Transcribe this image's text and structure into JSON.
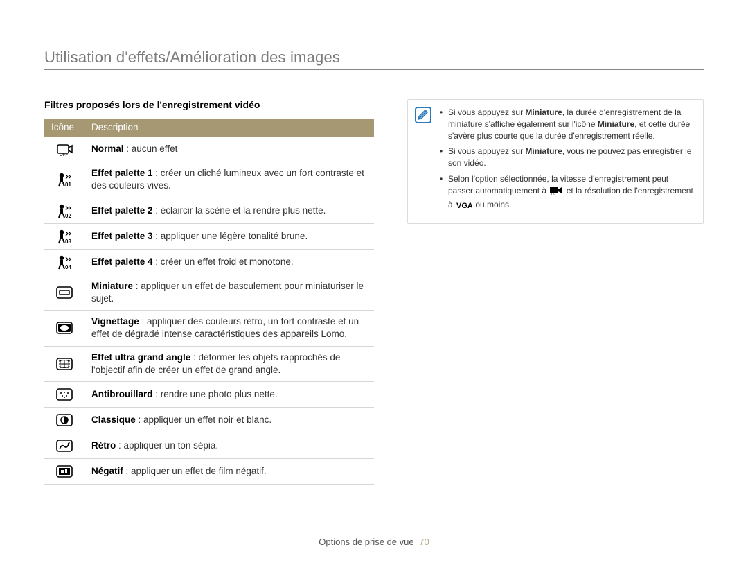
{
  "header": {
    "title": "Utilisation d'effets/Amélioration des images"
  },
  "section": {
    "heading": "Filtres proposés lors de l'enregistrement vidéo"
  },
  "table": {
    "col_icon": "Icône",
    "col_desc": "Description",
    "rows": [
      {
        "icon": "normal",
        "strong": "Normal",
        "body": " : aucun effet"
      },
      {
        "icon": "pal1",
        "strong": "Effet palette 1",
        "body": " : créer un cliché lumineux avec un fort contraste et des couleurs vives."
      },
      {
        "icon": "pal2",
        "strong": "Effet palette 2",
        "body": " : éclaircir la scène et la rendre plus nette."
      },
      {
        "icon": "pal3",
        "strong": "Effet palette 3",
        "body": " : appliquer une légère tonalité brune."
      },
      {
        "icon": "pal4",
        "strong": "Effet palette 4",
        "body": " : créer un effet froid et monotone."
      },
      {
        "icon": "miniature",
        "strong": "Miniature",
        "body": " : appliquer un effet de basculement pour miniaturiser le sujet."
      },
      {
        "icon": "vignette",
        "strong": "Vignettage",
        "body": " : appliquer des couleurs rétro, un fort contraste et un effet de dégradé intense caractéristiques des appareils Lomo."
      },
      {
        "icon": "fisheye",
        "strong": "Effet ultra grand angle",
        "body": " : déformer les objets rapprochés de l'objectif afin de créer un effet de grand angle."
      },
      {
        "icon": "defog",
        "strong": "Antibrouillard",
        "body": " : rendre une photo plus nette."
      },
      {
        "icon": "classic",
        "strong": "Classique",
        "body": " : appliquer un effet noir et blanc."
      },
      {
        "icon": "retro",
        "strong": "Rétro",
        "body": " : appliquer un ton sépia."
      },
      {
        "icon": "negative",
        "strong": "Négatif",
        "body": " : appliquer un effet de film négatif."
      }
    ]
  },
  "notes": {
    "items": [
      {
        "pre": "Si vous appuyez sur ",
        "b1": "Miniature",
        "mid": ", la durée d'enregistrement de la miniature s'affiche également sur l'icône ",
        "b2": "Miniature",
        "post": ", et cette durée s'avère plus courte que la durée d'enregistrement réelle."
      },
      {
        "pre": "Si vous appuyez sur ",
        "b1": "Miniature",
        "mid": ", vous ne pouvez pas enregistrer le son vidéo.",
        "b2": "",
        "post": ""
      },
      {
        "pre": "Selon l'option sélectionnée, la vitesse d'enregistrement peut passer automatiquement à ",
        "b1": "",
        "mid": "",
        "b2": "",
        "post": " et la résolution de l'enregistrement à ",
        "tail": " ou moins.",
        "has_inline_icons": true
      }
    ]
  },
  "footer": {
    "label": "Options de prise de vue",
    "page": "70"
  }
}
